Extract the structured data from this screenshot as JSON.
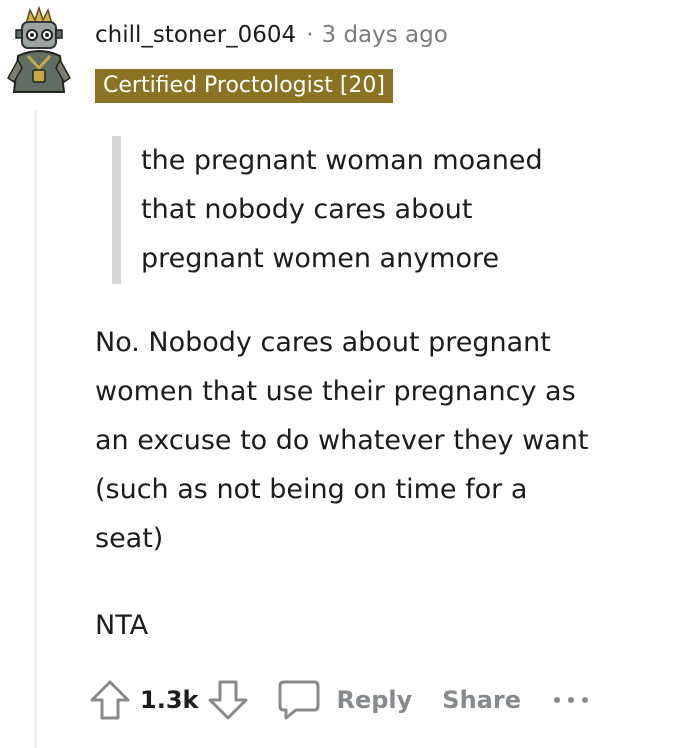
{
  "comment": {
    "username": "chill_stoner_0604",
    "separator": "·",
    "timestamp": "3 days ago",
    "flair": "Certified Proctologist [20]",
    "quote_lines": [
      "the pregnant woman moaned",
      "that nobody cares about",
      "pregnant women anymore"
    ],
    "body_lines": [
      "No. Nobody cares about pregnant",
      "women that use their pregnancy as",
      "an excuse to do whatever they want",
      "(such as not being on time for a",
      "seat)"
    ],
    "verdict": "NTA"
  },
  "actions": {
    "upvote_icon": "arrow-up-icon",
    "vote_count": "1.3k",
    "downvote_icon": "arrow-down-icon",
    "reply_icon": "speech-bubble-icon",
    "reply_label": "Reply",
    "share_label": "Share",
    "more_icon": "ellipsis-icon"
  },
  "colors": {
    "flair_background": "#8b7323",
    "muted_text": "#878a8c",
    "quote_bar": "#d6d6d6"
  }
}
